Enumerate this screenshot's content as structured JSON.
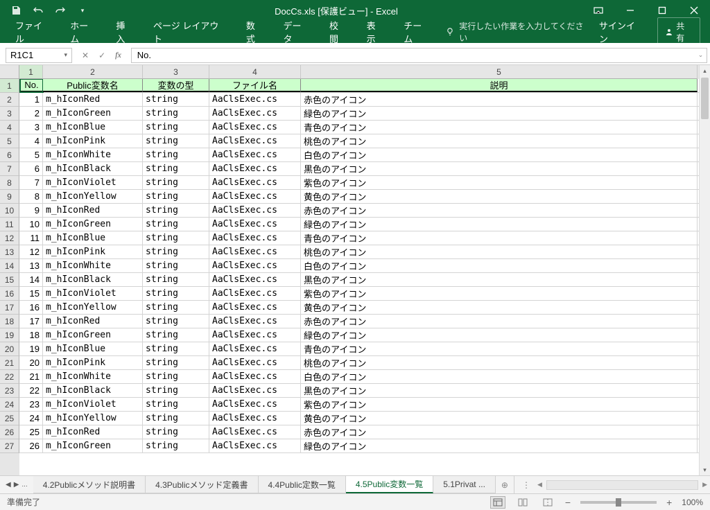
{
  "titlebar": {
    "title": "DocCs.xls [保護ビュー] - Excel"
  },
  "ribbon": {
    "tabs": [
      "ファイル",
      "ホーム",
      "挿入",
      "ページ レイアウト",
      "数式",
      "データ",
      "校閲",
      "表示",
      "チーム"
    ],
    "tell_me": "実行したい作業を入力してください",
    "signin": "サインイン",
    "share": "共有"
  },
  "namebox": "R1C1",
  "formula": "No.",
  "columns": [
    "1",
    "2",
    "3",
    "4",
    "5"
  ],
  "headers": [
    "No.",
    "Public変数名",
    "変数の型",
    "ファイル名",
    "説明"
  ],
  "rows": [
    {
      "no": 1,
      "name": "m_hIconRed",
      "type": "string",
      "file": "AaClsExec.cs",
      "desc": "赤色のアイコン"
    },
    {
      "no": 2,
      "name": "m_hIconGreen",
      "type": "string",
      "file": "AaClsExec.cs",
      "desc": "緑色のアイコン"
    },
    {
      "no": 3,
      "name": "m_hIconBlue",
      "type": "string",
      "file": "AaClsExec.cs",
      "desc": "青色のアイコン"
    },
    {
      "no": 4,
      "name": "m_hIconPink",
      "type": "string",
      "file": "AaClsExec.cs",
      "desc": "桃色のアイコン"
    },
    {
      "no": 5,
      "name": "m_hIconWhite",
      "type": "string",
      "file": "AaClsExec.cs",
      "desc": "白色のアイコン"
    },
    {
      "no": 6,
      "name": "m_hIconBlack",
      "type": "string",
      "file": "AaClsExec.cs",
      "desc": "黒色のアイコン"
    },
    {
      "no": 7,
      "name": "m_hIconViolet",
      "type": "string",
      "file": "AaClsExec.cs",
      "desc": "紫色のアイコン"
    },
    {
      "no": 8,
      "name": "m_hIconYellow",
      "type": "string",
      "file": "AaClsExec.cs",
      "desc": "黄色のアイコン"
    },
    {
      "no": 9,
      "name": "m_hIconRed",
      "type": "string",
      "file": "AaClsExec.cs",
      "desc": "赤色のアイコン"
    },
    {
      "no": 10,
      "name": "m_hIconGreen",
      "type": "string",
      "file": "AaClsExec.cs",
      "desc": "緑色のアイコン"
    },
    {
      "no": 11,
      "name": "m_hIconBlue",
      "type": "string",
      "file": "AaClsExec.cs",
      "desc": "青色のアイコン"
    },
    {
      "no": 12,
      "name": "m_hIconPink",
      "type": "string",
      "file": "AaClsExec.cs",
      "desc": "桃色のアイコン"
    },
    {
      "no": 13,
      "name": "m_hIconWhite",
      "type": "string",
      "file": "AaClsExec.cs",
      "desc": "白色のアイコン"
    },
    {
      "no": 14,
      "name": "m_hIconBlack",
      "type": "string",
      "file": "AaClsExec.cs",
      "desc": "黒色のアイコン"
    },
    {
      "no": 15,
      "name": "m_hIconViolet",
      "type": "string",
      "file": "AaClsExec.cs",
      "desc": "紫色のアイコン"
    },
    {
      "no": 16,
      "name": "m_hIconYellow",
      "type": "string",
      "file": "AaClsExec.cs",
      "desc": "黄色のアイコン"
    },
    {
      "no": 17,
      "name": "m_hIconRed",
      "type": "string",
      "file": "AaClsExec.cs",
      "desc": "赤色のアイコン"
    },
    {
      "no": 18,
      "name": "m_hIconGreen",
      "type": "string",
      "file": "AaClsExec.cs",
      "desc": "緑色のアイコン"
    },
    {
      "no": 19,
      "name": "m_hIconBlue",
      "type": "string",
      "file": "AaClsExec.cs",
      "desc": "青色のアイコン"
    },
    {
      "no": 20,
      "name": "m_hIconPink",
      "type": "string",
      "file": "AaClsExec.cs",
      "desc": "桃色のアイコン"
    },
    {
      "no": 21,
      "name": "m_hIconWhite",
      "type": "string",
      "file": "AaClsExec.cs",
      "desc": "白色のアイコン"
    },
    {
      "no": 22,
      "name": "m_hIconBlack",
      "type": "string",
      "file": "AaClsExec.cs",
      "desc": "黒色のアイコン"
    },
    {
      "no": 23,
      "name": "m_hIconViolet",
      "type": "string",
      "file": "AaClsExec.cs",
      "desc": "紫色のアイコン"
    },
    {
      "no": 24,
      "name": "m_hIconYellow",
      "type": "string",
      "file": "AaClsExec.cs",
      "desc": "黄色のアイコン"
    },
    {
      "no": 25,
      "name": "m_hIconRed",
      "type": "string",
      "file": "AaClsExec.cs",
      "desc": "赤色のアイコン"
    },
    {
      "no": 26,
      "name": "m_hIconGreen",
      "type": "string",
      "file": "AaClsExec.cs",
      "desc": "緑色のアイコン"
    }
  ],
  "sheet_tabs": {
    "ellipsis": "...",
    "items": [
      "4.2Publicメソッド説明書",
      "4.3Publicメソッド定義書",
      "4.4Public定数一覧",
      "4.5Public変数一覧",
      "5.1Privat  ..."
    ],
    "active_index": 3
  },
  "status": {
    "ready": "準備完了",
    "zoom": "100%"
  }
}
